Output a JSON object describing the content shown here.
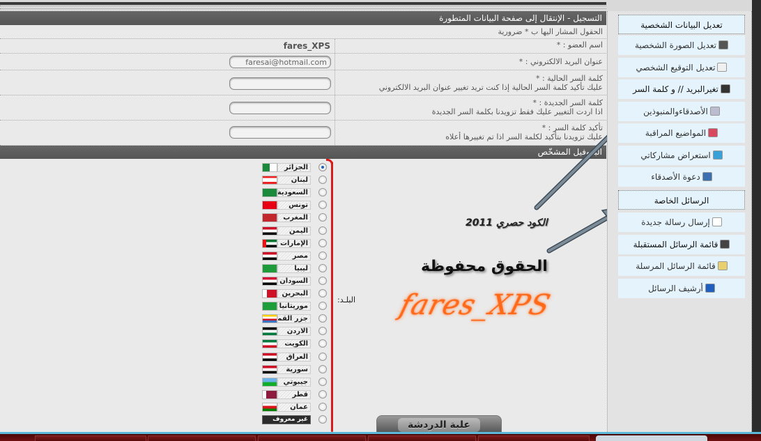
{
  "form": {
    "header_title": "التسجيل - الإنتقال إلى صفحة البيانات المتطورة",
    "required_note": "الحقول المشار اليها ب * ضرورية",
    "fields": [
      {
        "label": "اسم العضو : *",
        "hint": "",
        "value": "fares_XPS",
        "type": "static"
      },
      {
        "label": "عنوان البريد الالكتروني : *",
        "hint": "",
        "value": "faresai@hotmail.com",
        "type": "text"
      },
      {
        "label": "كلمة السر الحالية : *",
        "hint": "عليك تأكيد كلمة السر الحالية إذا كنت تريد تغيير عنوان البريد الالكتروني",
        "value": "",
        "type": "password"
      },
      {
        "label": "كلمة السر الجديدة : *",
        "hint": "اذا اردت التغيير عليك فقط تزويدنا بكلمة السر الجديدة",
        "value": "",
        "type": "password"
      },
      {
        "label": "تأكيد كلمة السر : *",
        "hint": "عليك تزويدنا بتأكيد لكلمة السر اذا تم تغييرها أعلاه",
        "value": "",
        "type": "password"
      }
    ],
    "profile_header": "البروفيل المشخّص",
    "country_label": "البلـد:",
    "countries": [
      {
        "name": "الجزائر",
        "flag": "algeria",
        "selected": true
      },
      {
        "name": "لبنان",
        "flag": "lebanon",
        "selected": false
      },
      {
        "name": "السعودية",
        "flag": "saudi",
        "selected": false
      },
      {
        "name": "تونس",
        "flag": "tunisia",
        "selected": false
      },
      {
        "name": "المغرب",
        "flag": "morocco",
        "selected": false
      },
      {
        "name": "اليمن",
        "flag": "yemen",
        "selected": false
      },
      {
        "name": "الإمارات",
        "flag": "uae",
        "selected": false
      },
      {
        "name": "مصر",
        "flag": "egypt",
        "selected": false
      },
      {
        "name": "ليبيا",
        "flag": "libya",
        "selected": false
      },
      {
        "name": "السودان",
        "flag": "sudan",
        "selected": false
      },
      {
        "name": "البحرين",
        "flag": "bahrain",
        "selected": false
      },
      {
        "name": "موريتانيا",
        "flag": "mauritania",
        "selected": false
      },
      {
        "name": "جزر القمر",
        "flag": "comoros",
        "selected": false
      },
      {
        "name": "الاردن",
        "flag": "jordan",
        "selected": false
      },
      {
        "name": "الكويت",
        "flag": "kuwait",
        "selected": false
      },
      {
        "name": "العراق",
        "flag": "iraq",
        "selected": false
      },
      {
        "name": "سورية",
        "flag": "syria",
        "selected": false
      },
      {
        "name": "جيبوتي",
        "flag": "djibouti",
        "selected": false
      },
      {
        "name": "قطر",
        "flag": "qatar",
        "selected": false
      },
      {
        "name": "عمان",
        "flag": "oman",
        "selected": false
      },
      {
        "name": "غير معروف",
        "flag": "none",
        "selected": false
      }
    ]
  },
  "watermark": {
    "code_note": "الكود حصري 2011",
    "rights": "الحقوق محفوظة",
    "signature": "fares_XPS"
  },
  "chat_tab": {
    "label": "علبة الدردشة"
  },
  "sidebar": {
    "profile_heading": "تعديل البيانات الشخصية",
    "profile_items": [
      {
        "label": "تعديل الصورة الشخصية",
        "icon": "camera-icon",
        "bold": false
      },
      {
        "label": "تعديل التوقيع الشخصي",
        "icon": "palette-icon",
        "bold": false
      },
      {
        "label": "تغيرالبريد // و كلمة السر",
        "icon": "cursor-icon",
        "bold": true
      },
      {
        "label": "الأصدقاءوالمنبوذين",
        "icon": "friends-icon",
        "bold": false
      },
      {
        "label": "المواضيع المراقبة",
        "icon": "watched-icon",
        "bold": false
      },
      {
        "label": "استعراض مشاركاتي",
        "icon": "posts-icon",
        "bold": false
      },
      {
        "label": "دعوة الأصدقاء",
        "icon": "invite-icon",
        "bold": false
      }
    ],
    "messages_heading": "الرسائل الخاصة",
    "message_items": [
      {
        "label": "إرسال رسالة جديدة",
        "icon": "new-message-icon",
        "bold": false
      },
      {
        "label": "قائمة الرسائل المستقبلة",
        "icon": "inbox-arrow-icon",
        "bold": true
      },
      {
        "label": "قائمة الرسائل المرسلة",
        "icon": "sent-folder-icon",
        "bold": false
      },
      {
        "label": "أرشيف الرسائل",
        "icon": "info-icon",
        "bold": false
      }
    ]
  }
}
